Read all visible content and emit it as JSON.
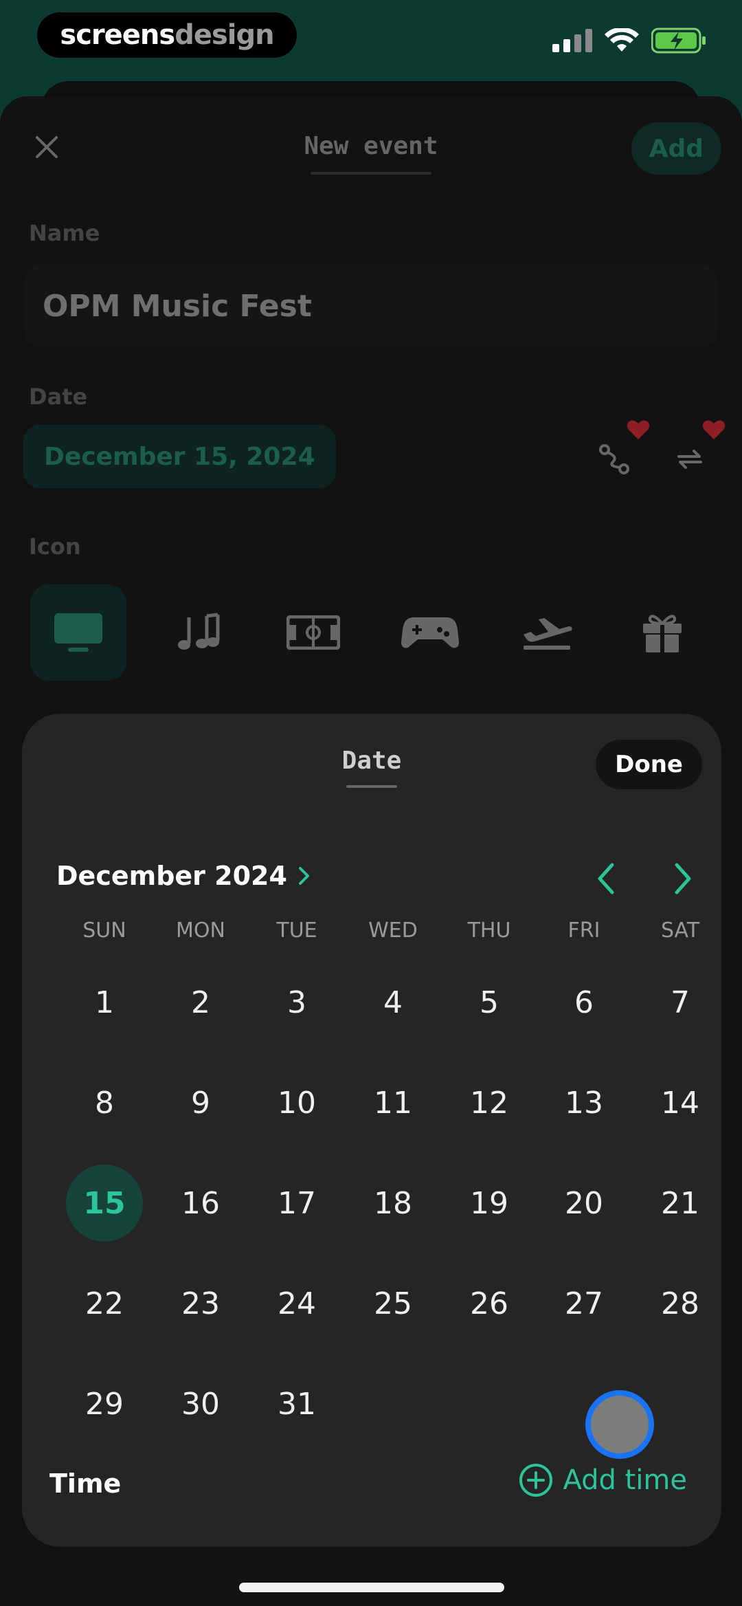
{
  "status_bar": {
    "brand_part1": "screens",
    "brand_part2": "design",
    "icons": [
      "signal-icon",
      "wifi-icon",
      "battery-charging-icon"
    ]
  },
  "new_event": {
    "title": "New event",
    "add_label": "Add",
    "name_label": "Name",
    "name_value": "OPM Music Fest",
    "date_label": "Date",
    "date_value": "December 15, 2024",
    "icon_label": "Icon",
    "icons": [
      "tv-icon",
      "music-notes-icon",
      "stadium-icon",
      "gamepad-icon",
      "airplane-icon",
      "gift-icon"
    ],
    "selected_icon": "tv-icon"
  },
  "date_picker": {
    "title": "Date",
    "done_label": "Done",
    "month_label": "December 2024",
    "weekdays": [
      "SUN",
      "MON",
      "TUE",
      "WED",
      "THU",
      "FRI",
      "SAT"
    ],
    "days": [
      "1",
      "2",
      "3",
      "4",
      "5",
      "6",
      "7",
      "8",
      "9",
      "10",
      "11",
      "12",
      "13",
      "14",
      "15",
      "16",
      "17",
      "18",
      "19",
      "20",
      "21",
      "22",
      "23",
      "24",
      "25",
      "26",
      "27",
      "28",
      "29",
      "30",
      "31"
    ],
    "selected_day": "15",
    "time_label": "Time",
    "add_time_label": "Add time"
  },
  "colors": {
    "accent": "#2cc49a",
    "accent_bg": "#0b3e34",
    "picker_bg": "#262526",
    "heart": "#b3232d",
    "touch_ring": "#1a73f0"
  }
}
